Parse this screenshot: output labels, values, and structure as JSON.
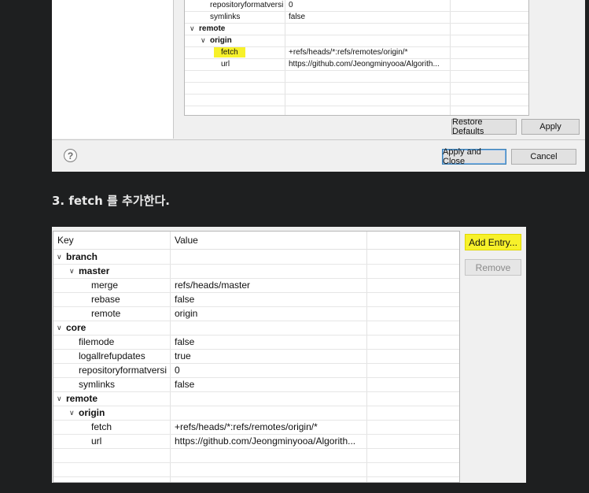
{
  "top_dialog": {
    "rows": [
      {
        "key": "repositoryformatversi",
        "value": "0",
        "level": 1,
        "bold": false,
        "expander": false,
        "highlight": false
      },
      {
        "key": "symlinks",
        "value": "false",
        "level": 1,
        "bold": false,
        "expander": false,
        "highlight": false
      },
      {
        "key": "remote",
        "value": "",
        "level": 0,
        "bold": true,
        "expander": true,
        "highlight": false
      },
      {
        "key": "origin",
        "value": "",
        "level": 1,
        "bold": true,
        "expander": true,
        "highlight": false
      },
      {
        "key": "fetch",
        "value": "+refs/heads/*:refs/remotes/origin/*",
        "level": 2,
        "bold": false,
        "expander": false,
        "highlight": true
      },
      {
        "key": "url",
        "value": "https://github.com/Jeongminyooa/Algorith...",
        "level": 2,
        "bold": false,
        "expander": false,
        "highlight": false
      },
      {
        "key": "",
        "value": "",
        "level": 0,
        "bold": false,
        "expander": false,
        "highlight": false
      },
      {
        "key": "",
        "value": "",
        "level": 0,
        "bold": false,
        "expander": false,
        "highlight": false
      },
      {
        "key": "",
        "value": "",
        "level": 0,
        "bold": false,
        "expander": false,
        "highlight": false
      }
    ],
    "restore_defaults_label": "Restore Defaults",
    "apply_label": "Apply",
    "apply_close_label": "Apply and Close",
    "cancel_label": "Cancel",
    "help_glyph": "?"
  },
  "heading": "3. fetch 를 추가한다.",
  "bottom_dialog": {
    "header_key": "Key",
    "header_value": "Value",
    "rows": [
      {
        "key": "branch",
        "value": "",
        "level": 0,
        "bold": true,
        "expander": true
      },
      {
        "key": "master",
        "value": "",
        "level": 1,
        "bold": true,
        "expander": true
      },
      {
        "key": "merge",
        "value": "refs/heads/master",
        "level": 2,
        "bold": false,
        "expander": false
      },
      {
        "key": "rebase",
        "value": "false",
        "level": 2,
        "bold": false,
        "expander": false
      },
      {
        "key": "remote",
        "value": "origin",
        "level": 2,
        "bold": false,
        "expander": false
      },
      {
        "key": "core",
        "value": "",
        "level": 0,
        "bold": true,
        "expander": true
      },
      {
        "key": "filemode",
        "value": "false",
        "level": 1,
        "bold": false,
        "expander": false
      },
      {
        "key": "logallrefupdates",
        "value": "true",
        "level": 1,
        "bold": false,
        "expander": false
      },
      {
        "key": "repositoryformatversi",
        "value": "0",
        "level": 1,
        "bold": false,
        "expander": false
      },
      {
        "key": "symlinks",
        "value": "false",
        "level": 1,
        "bold": false,
        "expander": false
      },
      {
        "key": "remote",
        "value": "",
        "level": 0,
        "bold": true,
        "expander": true
      },
      {
        "key": "origin",
        "value": "",
        "level": 1,
        "bold": true,
        "expander": true
      },
      {
        "key": "fetch",
        "value": "+refs/heads/*:refs/remotes/origin/*",
        "level": 2,
        "bold": false,
        "expander": false
      },
      {
        "key": "url",
        "value": "https://github.com/Jeongminyooa/Algorith...",
        "level": 2,
        "bold": false,
        "expander": false
      },
      {
        "key": "",
        "value": "",
        "level": 0,
        "bold": false,
        "expander": false
      },
      {
        "key": "",
        "value": "",
        "level": 0,
        "bold": false,
        "expander": false
      },
      {
        "key": "",
        "value": "",
        "level": 0,
        "bold": false,
        "expander": false
      }
    ],
    "add_entry_label": "Add Entry...",
    "remove_label": "Remove"
  },
  "colors": {
    "highlight": "#f7f12a",
    "page_background": "#1e1f20",
    "dialog_background": "#f0f0f0"
  },
  "icons": {
    "expanded": "chevron-down-icon",
    "help": "help-icon"
  }
}
